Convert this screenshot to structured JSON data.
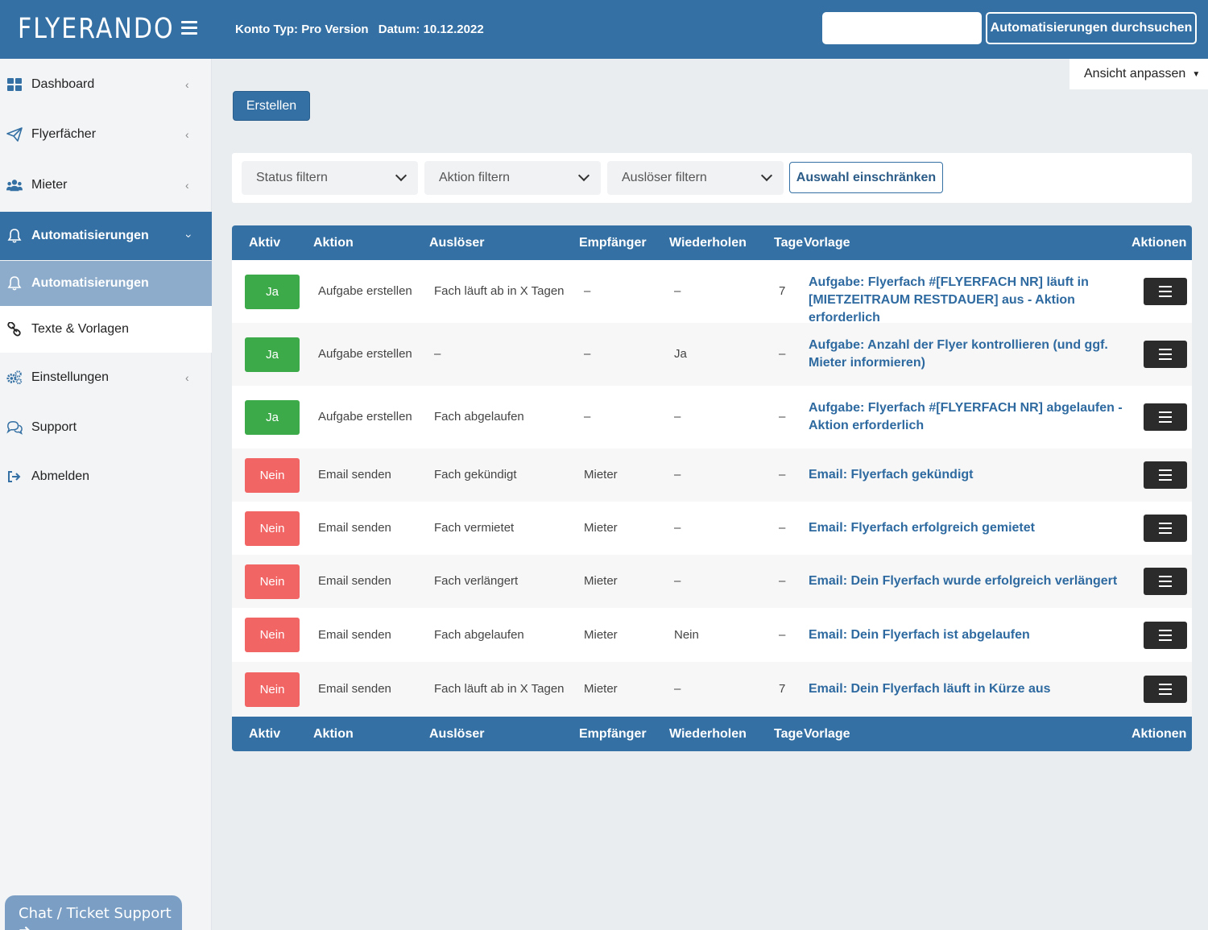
{
  "header": {
    "logo": "FLYERANDO",
    "account_type": "Konto Typ: Pro Version",
    "date": "Datum: 10.12.2022",
    "search_placeholder": "",
    "search_button": "Automatisierungen durchsuchen"
  },
  "sidebar": {
    "items": [
      {
        "label": "Dashboard",
        "icon": "dashboard-icon"
      },
      {
        "label": "Flyerfächer",
        "icon": "paper-plane-icon"
      },
      {
        "label": "Mieter",
        "icon": "users-icon"
      },
      {
        "label": "Automatisierungen",
        "icon": "bell-icon"
      },
      {
        "label": "Automatisierungen",
        "icon": "bell-icon"
      },
      {
        "label": "Texte & Vorlagen",
        "icon": "link-icon"
      },
      {
        "label": "Einstellungen",
        "icon": "gears-icon"
      },
      {
        "label": "Support",
        "icon": "chat-bubbles-icon"
      },
      {
        "label": "Abmelden",
        "icon": "sign-out-icon"
      }
    ],
    "chat_button": "Chat / Ticket Support ➜"
  },
  "toolbar": {
    "view_adjust": "Ansicht anpassen",
    "create_button": "Erstellen"
  },
  "filters": {
    "status": "Status filtern",
    "action": "Aktion filtern",
    "trigger": "Auslöser filtern",
    "restrict_button": "Auswahl einschränken"
  },
  "table": {
    "columns": [
      "Aktiv",
      "Aktion",
      "Auslöser",
      "Empfänger",
      "Wiederholen",
      "Tage",
      "Vorlage",
      "Aktionen"
    ],
    "rows": [
      {
        "active": "Ja",
        "action": "Aufgabe erstellen",
        "trigger": "Fach läuft ab in X Tagen",
        "recipient": "–",
        "repeat": "–",
        "days": "7",
        "template": "Aufgabe: Flyerfach #[FLYERFACH NR] läuft in [MIETZEITRAUM RESTDAUER] aus - Aktion erforderlich"
      },
      {
        "active": "Ja",
        "action": "Aufgabe erstellen",
        "trigger": "–",
        "recipient": "–",
        "repeat": "Ja",
        "days": "–",
        "template": "Aufgabe: Anzahl der Flyer kontrollieren (und ggf. Mieter informieren)"
      },
      {
        "active": "Ja",
        "action": "Aufgabe erstellen",
        "trigger": "Fach abgelaufen",
        "recipient": "–",
        "repeat": "–",
        "days": "–",
        "template": "Aufgabe: Flyerfach #[FLYERFACH NR] abgelaufen - Aktion erforderlich"
      },
      {
        "active": "Nein",
        "action": "Email senden",
        "trigger": "Fach gekündigt",
        "recipient": "Mieter",
        "repeat": "–",
        "days": "–",
        "template": "Email: Flyerfach gekündigt"
      },
      {
        "active": "Nein",
        "action": "Email senden",
        "trigger": "Fach vermietet",
        "recipient": "Mieter",
        "repeat": "–",
        "days": "–",
        "template": "Email: Flyerfach erfolgreich gemietet"
      },
      {
        "active": "Nein",
        "action": "Email senden",
        "trigger": "Fach verlängert",
        "recipient": "Mieter",
        "repeat": "–",
        "days": "–",
        "template": "Email: Dein Flyerfach wurde erfolgreich verlängert"
      },
      {
        "active": "Nein",
        "action": "Email senden",
        "trigger": "Fach abgelaufen",
        "recipient": "Mieter",
        "repeat": "Nein",
        "days": "–",
        "template": "Email: Dein Flyerfach ist abgelaufen"
      },
      {
        "active": "Nein",
        "action": "Email senden",
        "trigger": "Fach läuft ab in X Tagen",
        "recipient": "Mieter",
        "repeat": "–",
        "days": "7",
        "template": "Email: Dein Flyerfach läuft in Kürze aus"
      }
    ]
  },
  "colors": {
    "primary": "#3470a3",
    "active_yes": "#3daa4a",
    "active_no": "#f16565",
    "link": "#2e6aa0"
  }
}
